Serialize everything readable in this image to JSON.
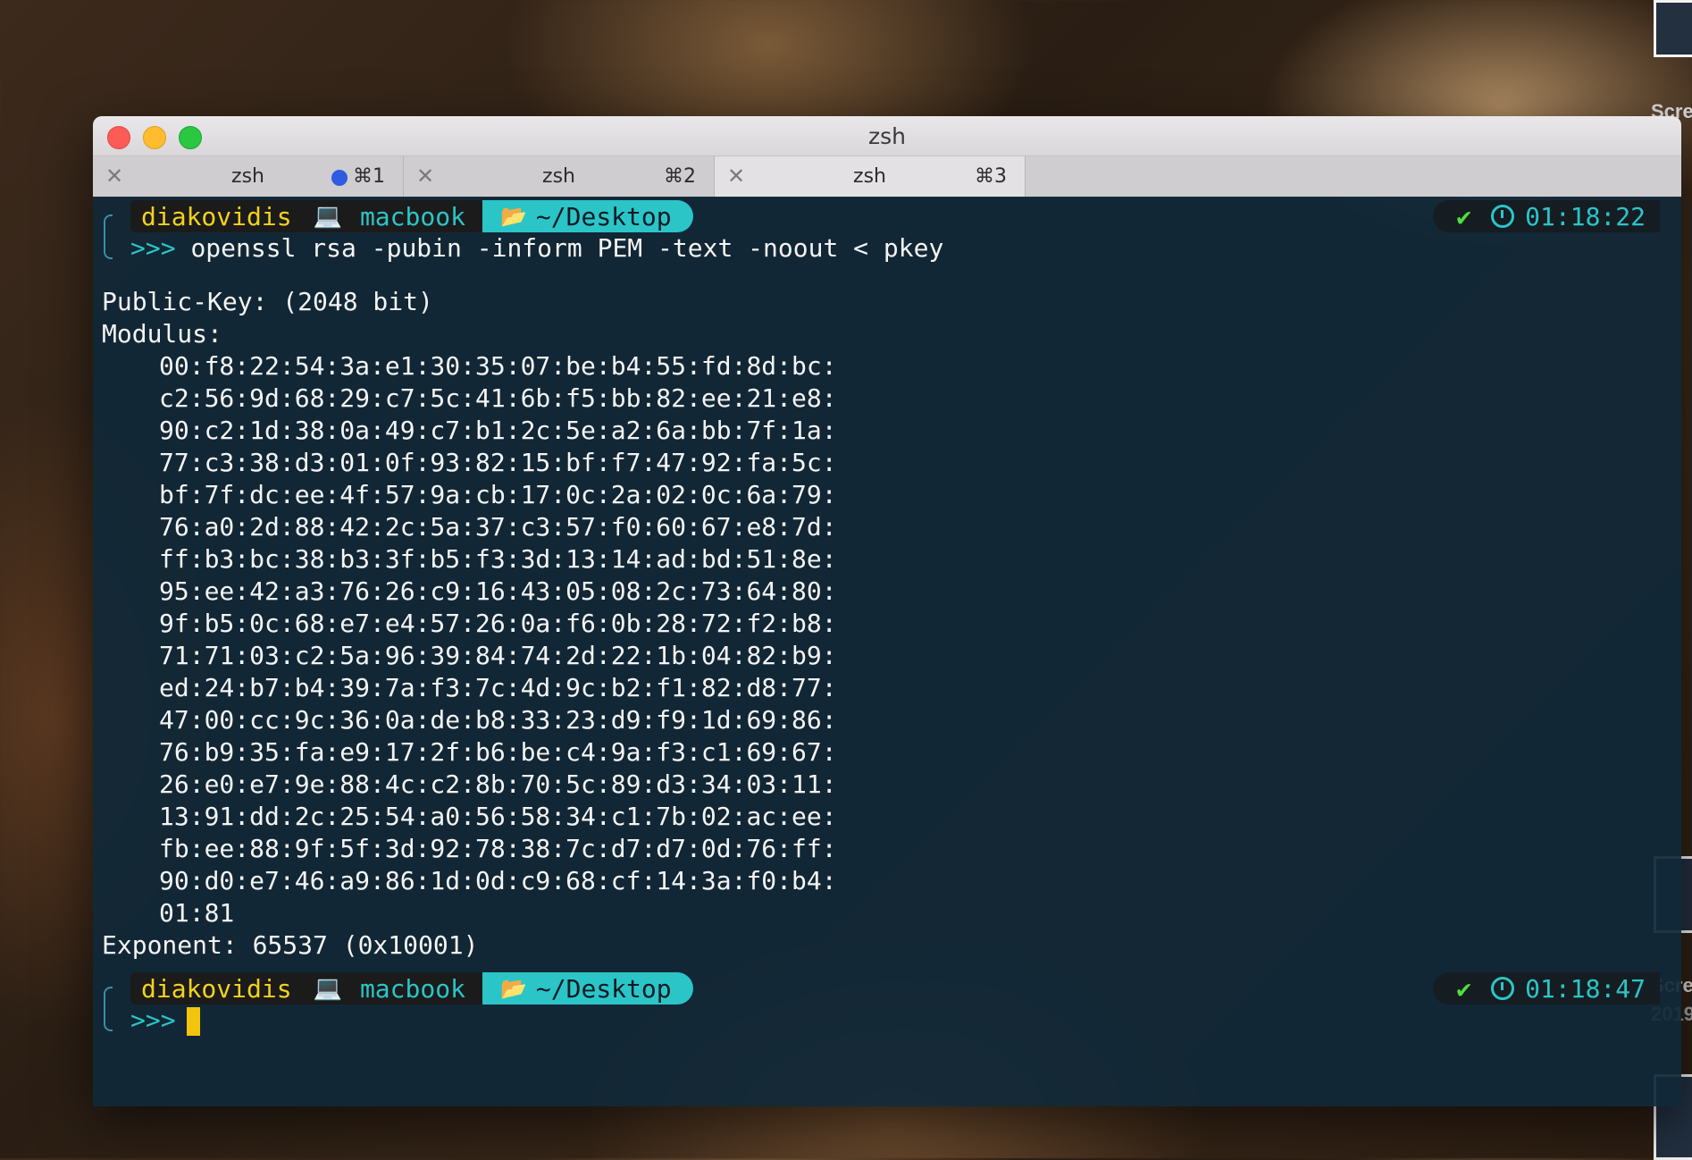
{
  "desktop": {
    "labels": [
      "Scre",
      "Scre",
      "2019"
    ]
  },
  "window": {
    "title": "zsh"
  },
  "tabs": [
    {
      "name": "zsh",
      "shortcut": "⌘1",
      "active": false,
      "has_activity_dot": true
    },
    {
      "name": "zsh",
      "shortcut": "⌘2",
      "active": false,
      "has_activity_dot": false
    },
    {
      "name": "zsh",
      "shortcut": "⌘3",
      "active": true,
      "has_activity_dot": false
    }
  ],
  "prompts": [
    {
      "user": "diakovidis",
      "host": "macbook",
      "dir": "~/Desktop",
      "chevrons": ">>>",
      "command": "openssl rsa -pubin -inform PEM -text -noout < pkey",
      "time": "01:18:22"
    },
    {
      "user": "diakovidis",
      "host": "macbook",
      "dir": "~/Desktop",
      "chevrons": ">>>",
      "command": "",
      "time": "01:18:47"
    }
  ],
  "output": {
    "public_key": "Public-Key: (2048 bit)",
    "modulus_label": "Modulus:",
    "modulus_lines": [
      "00:f8:22:54:3a:e1:30:35:07:be:b4:55:fd:8d:bc:",
      "c2:56:9d:68:29:c7:5c:41:6b:f5:bb:82:ee:21:e8:",
      "90:c2:1d:38:0a:49:c7:b1:2c:5e:a2:6a:bb:7f:1a:",
      "77:c3:38:d3:01:0f:93:82:15:bf:f7:47:92:fa:5c:",
      "bf:7f:dc:ee:4f:57:9a:cb:17:0c:2a:02:0c:6a:79:",
      "76:a0:2d:88:42:2c:5a:37:c3:57:f0:60:67:e8:7d:",
      "ff:b3:bc:38:b3:3f:b5:f3:3d:13:14:ad:bd:51:8e:",
      "95:ee:42:a3:76:26:c9:16:43:05:08:2c:73:64:80:",
      "9f:b5:0c:68:e7:e4:57:26:0a:f6:0b:28:72:f2:b8:",
      "71:71:03:c2:5a:96:39:84:74:2d:22:1b:04:82:b9:",
      "ed:24:b7:b4:39:7a:f3:7c:4d:9c:b2:f1:82:d8:77:",
      "47:00:cc:9c:36:0a:de:b8:33:23:d9:f9:1d:69:86:",
      "76:b9:35:fa:e9:17:2f:b6:be:c4:9a:f3:c1:69:67:",
      "26:e0:e7:9e:88:4c:c2:8b:70:5c:89:d3:34:03:11:",
      "13:91:dd:2c:25:54:a0:56:58:34:c1:7b:02:ac:ee:",
      "fb:ee:88:9f:5f:3d:92:78:38:7c:d7:d7:0d:76:ff:",
      "90:d0:e7:46:a9:86:1d:0d:c9:68:cf:14:3a:f0:b4:",
      "01:81"
    ],
    "exponent": "Exponent: 65537 (0x10001)"
  },
  "colors": {
    "prompt_user": "#f2d21e",
    "prompt_accent": "#2bc5c8",
    "status_ok": "#4fe03c",
    "cursor": "#f2c40e",
    "terminal_bg": "#102838"
  },
  "icons": {
    "host": "laptop-icon",
    "dir": "folder-open-icon",
    "status": "check-icon",
    "time": "clock-icon",
    "tab_close": "close-icon"
  }
}
